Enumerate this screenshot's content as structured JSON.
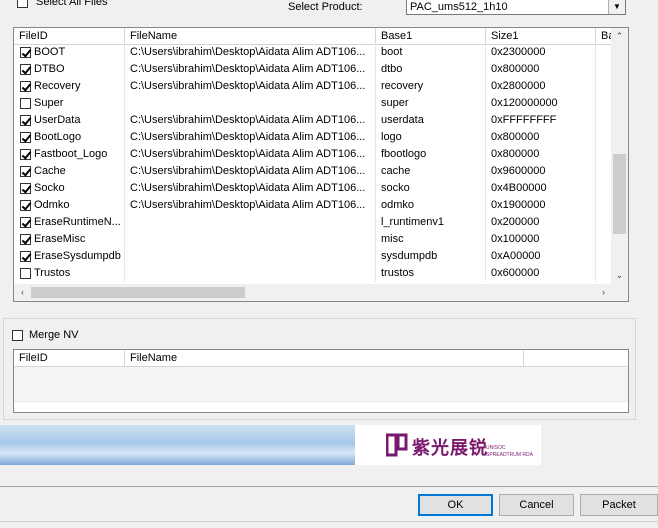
{
  "top": {
    "select_all_label": "Select All Files",
    "select_product_label": "Select Product:",
    "product_value": "PAC_ums512_1h10"
  },
  "files_list": {
    "columns": [
      "FileID",
      "FileName",
      "Base1",
      "Size1",
      "Ba"
    ],
    "rows": [
      {
        "checked": true,
        "id": "BOOT",
        "name": "C:\\Users\\ibrahim\\Desktop\\Aidata Alim ADT106...",
        "base": "boot",
        "size": "0x2300000"
      },
      {
        "checked": true,
        "id": "DTBO",
        "name": "C:\\Users\\ibrahim\\Desktop\\Aidata Alim ADT106...",
        "base": "dtbo",
        "size": "0x800000"
      },
      {
        "checked": true,
        "id": "Recovery",
        "name": "C:\\Users\\ibrahim\\Desktop\\Aidata Alim ADT106...",
        "base": "recovery",
        "size": "0x2800000"
      },
      {
        "checked": false,
        "id": "Super",
        "name": "",
        "base": "super",
        "size": "0x120000000"
      },
      {
        "checked": true,
        "id": "UserData",
        "name": "C:\\Users\\ibrahim\\Desktop\\Aidata Alim ADT106...",
        "base": "userdata",
        "size": "0xFFFFFFFF"
      },
      {
        "checked": true,
        "id": "BootLogo",
        "name": "C:\\Users\\ibrahim\\Desktop\\Aidata Alim ADT106...",
        "base": "logo",
        "size": "0x800000"
      },
      {
        "checked": true,
        "id": "Fastboot_Logo",
        "name": "C:\\Users\\ibrahim\\Desktop\\Aidata Alim ADT106...",
        "base": "fbootlogo",
        "size": "0x800000"
      },
      {
        "checked": true,
        "id": "Cache",
        "name": "C:\\Users\\ibrahim\\Desktop\\Aidata Alim ADT106...",
        "base": "cache",
        "size": "0x9600000"
      },
      {
        "checked": true,
        "id": "Socko",
        "name": "C:\\Users\\ibrahim\\Desktop\\Aidata Alim ADT106...",
        "base": "socko",
        "size": "0x4B00000"
      },
      {
        "checked": true,
        "id": "Odmko",
        "name": "C:\\Users\\ibrahim\\Desktop\\Aidata Alim ADT106...",
        "base": "odmko",
        "size": "0x1900000"
      },
      {
        "checked": true,
        "id": "EraseRuntimeN...",
        "name": "",
        "base": "l_runtimenv1",
        "size": "0x200000"
      },
      {
        "checked": true,
        "id": "EraseMisc",
        "name": "",
        "base": "misc",
        "size": "0x100000"
      },
      {
        "checked": true,
        "id": "EraseSysdumpdb",
        "name": "",
        "base": "sysdumpdb",
        "size": "0xA00000"
      },
      {
        "checked": false,
        "id": "Trustos",
        "name": "",
        "base": "trustos",
        "size": "0x600000"
      }
    ]
  },
  "merge": {
    "merge_nv_label": "Merge NV",
    "columns": [
      "FileID",
      "FileName"
    ]
  },
  "banner": {
    "logo_cn": "紫光展锐",
    "logo_en_line1": "UNISOC",
    "logo_en_line2": "SPREADTRUM RDA"
  },
  "buttons": {
    "ok": "OK",
    "cancel": "Cancel",
    "packet": "Packet"
  },
  "colors": {
    "logo": "#7a1a6e",
    "focus": "#0078d7"
  }
}
